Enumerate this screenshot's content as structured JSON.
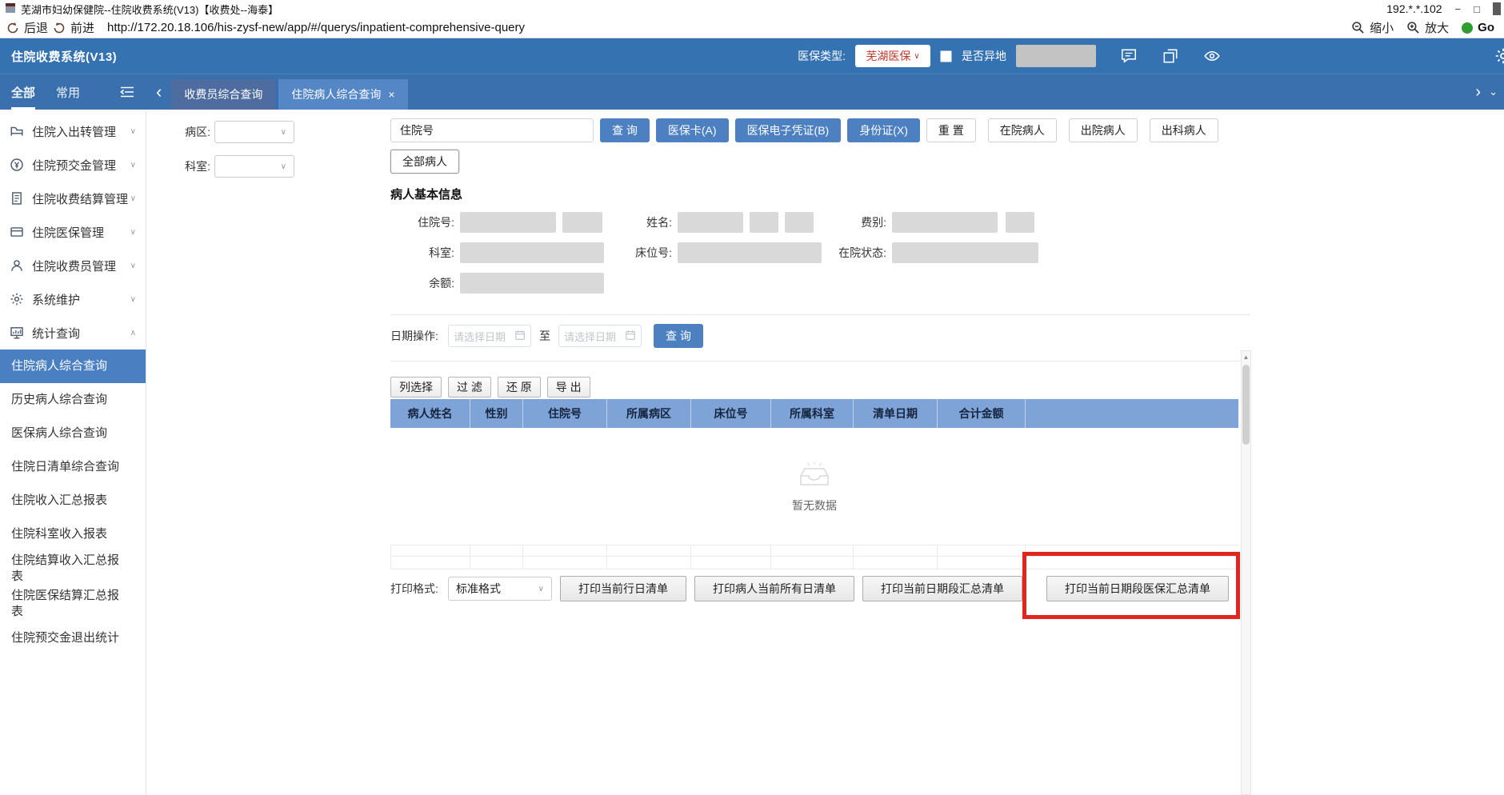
{
  "titlebar": {
    "title": "芜湖市妇幼保健院--住院收费系统(V13)【收费处--海泰】",
    "ip": "192.*.*.102"
  },
  "browserbar": {
    "back": "后退",
    "forward": "前进",
    "url": "http://172.20.18.106/his-zysf-new/app/#/querys/inpatient-comprehensive-query",
    "zoom_out": "缩小",
    "zoom_in": "放大",
    "go": "Go"
  },
  "appheader": {
    "title": "住院收费系统(V13)",
    "insurance_type_label": "医保类型:",
    "insurance_type_value": "芜湖医保",
    "is_remote_label": "是否异地"
  },
  "tabbar": {
    "nav": [
      {
        "label": "全部"
      },
      {
        "label": "常用"
      }
    ],
    "tabs": [
      {
        "label": "收费员综合查询"
      },
      {
        "label": "住院病人综合查询"
      }
    ]
  },
  "sidebar": {
    "menu": [
      {
        "label": "住院入出转管理"
      },
      {
        "label": "住院预交金管理"
      },
      {
        "label": "住院收费结算管理"
      },
      {
        "label": "住院医保管理"
      },
      {
        "label": "住院收费员管理"
      },
      {
        "label": "系统维护"
      },
      {
        "label": "统计查询"
      }
    ],
    "submenu": [
      {
        "label": "住院病人综合查询"
      },
      {
        "label": "历史病人综合查询"
      },
      {
        "label": "医保病人综合查询"
      },
      {
        "label": "住院日清单综合查询"
      },
      {
        "label": "住院收入汇总报表"
      },
      {
        "label": "住院科室收入报表"
      },
      {
        "label": "住院结算收入汇总报表"
      },
      {
        "label": "住院医保结算汇总报表"
      },
      {
        "label": "住院预交金退出统计"
      }
    ]
  },
  "filters": {
    "ward_label": "病区:",
    "dept_label": "科室:"
  },
  "search": {
    "inpatient_no_label": "住院号",
    "query_btn": "查 询",
    "insurance_card_btn": "医保卡(A)",
    "e_voucher_btn": "医保电子凭证(B)",
    "id_card_btn": "身份证(X)",
    "reset_btn": "重 置",
    "in_hospital_btn": "在院病人",
    "discharged_btn": "出院病人",
    "out_dept_btn": "出科病人",
    "all_patients_btn": "全部病人"
  },
  "patient_info": {
    "section_title": "病人基本信息",
    "fields": {
      "inpatient_no": "住院号:",
      "name": "姓名:",
      "fee_type": "费别:",
      "dept": "科室:",
      "bed_no": "床位号:",
      "status": "在院状态:",
      "balance": "余额:"
    }
  },
  "date_section": {
    "label": "日期操作:",
    "start_placeholder": "请选择日期",
    "to": "至",
    "end_placeholder": "请选择日期",
    "query_btn": "查 询"
  },
  "table": {
    "toolbar": [
      "列选择",
      "过 滤",
      "还 原",
      "导 出"
    ],
    "columns": [
      "病人姓名",
      "性别",
      "住院号",
      "所属病区",
      "床位号",
      "所属科室",
      "清单日期",
      "合计金额"
    ],
    "empty_text": "暂无数据"
  },
  "print": {
    "format_label": "打印格式:",
    "format_value": "标准格式",
    "buttons": [
      "打印当前行日清单",
      "打印病人当前所有日清单",
      "打印当前日期段汇总清单",
      "打印当前日期段医保汇总清单"
    ],
    "highlighted_button": "打印当前日期段医保汇总清单"
  },
  "icons": {
    "chevron_down": "∨",
    "chevron_up": "∧",
    "chevron_left": "‹",
    "chevron_right": "›",
    "small_down": "⌄",
    "close": "×",
    "minimize": "−",
    "restore": "□",
    "arrow_up": "▲"
  },
  "colors": {
    "header_blue": "#3472b2",
    "accent_blue": "#4d80c1",
    "table_header_blue": "#7ea3d7",
    "highlight_red": "#e2251d",
    "insurance_red": "#c13528"
  }
}
